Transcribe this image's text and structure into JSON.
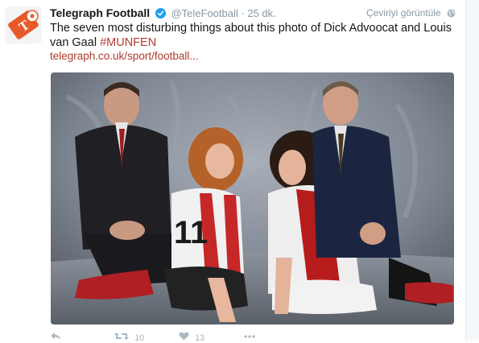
{
  "tweet": {
    "account_name": "Telegraph Football",
    "handle": "@TeleFootball",
    "separator": "·",
    "time": "25 dk.",
    "translate_label": "Çeviriyi görüntüle",
    "text_main": "The seven most disturbing things about this photo of Dick Advoocat and Louis van Gaal ",
    "hashtag": "#MUNFEN",
    "link": "telegraph.co.uk/sport/football...",
    "retweet_count": "10",
    "like_count": "13"
  },
  "colors": {
    "accent": "#b03a2e",
    "verified_blue": "#1da1f2",
    "logo_orange": "#e8592a",
    "muted": "#8899a6"
  },
  "icons": {
    "avatar": "telegraph-football-logo",
    "verified": "verified-badge-icon",
    "globe": "globe-icon",
    "reply": "reply-icon",
    "retweet": "retweet-icon",
    "like": "heart-icon",
    "more": "more-icon"
  }
}
